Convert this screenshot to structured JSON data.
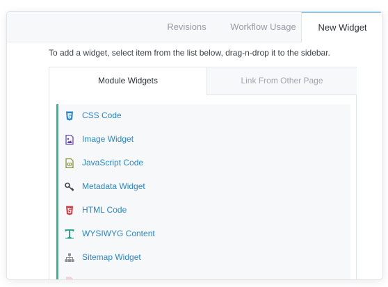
{
  "tabs": [
    {
      "label": "Revisions",
      "active": false
    },
    {
      "label": "Workflow Usage",
      "active": false
    },
    {
      "label": "New Widget",
      "active": true
    }
  ],
  "hint": "To add a widget, select item from the list below, drag-n-drop it to the sidebar.",
  "subtabs": [
    {
      "label": "Module Widgets",
      "active": true
    },
    {
      "label": "Link From Other Page",
      "active": false
    }
  ],
  "widgets": [
    {
      "label": "CSS Code",
      "icon": "css3-icon",
      "color": "#2a86c9"
    },
    {
      "label": "Image Widget",
      "icon": "image-icon",
      "color": "#5b3fa8"
    },
    {
      "label": "JavaScript Code",
      "icon": "javascript-file-icon",
      "color": "#7c8a2e"
    },
    {
      "label": "Metadata Widget",
      "icon": "key-icon",
      "color": "#3b3f44"
    },
    {
      "label": "HTML Code",
      "icon": "html5-icon",
      "color": "#d2383e"
    },
    {
      "label": "WYSIWYG Content",
      "icon": "text-format-icon",
      "color": "#1f9e86"
    },
    {
      "label": "Sitemap Widget",
      "icon": "sitemap-icon",
      "color": "#8d9197"
    }
  ],
  "colors": {
    "accent": "#2e96d6",
    "list_border": "#2fb894",
    "link": "#2a86c9"
  }
}
